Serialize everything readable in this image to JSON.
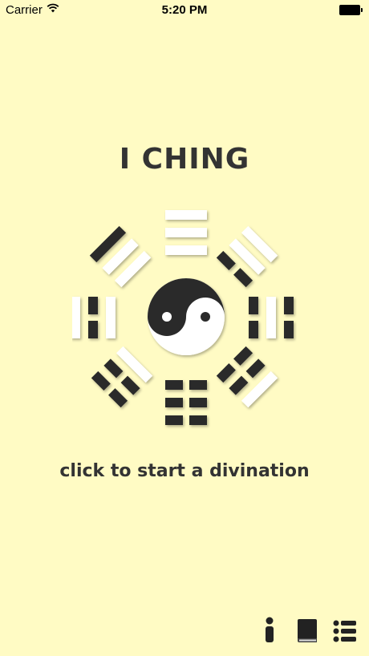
{
  "status_bar": {
    "carrier": "Carrier",
    "time": "5:20 PM",
    "wifi_icon": "wifi-icon",
    "battery_icon": "battery-full-icon"
  },
  "title": "I CHING",
  "bagua": {
    "center_icon": "yin-yang-icon",
    "trigram_dark": "#2b2b2b",
    "trigram_light": "#ffffff"
  },
  "prompt": "click to start a divination",
  "toolbar": {
    "info_icon": "info-icon",
    "book_icon": "book-icon",
    "list_icon": "list-icon"
  },
  "colors": {
    "background": "#fffbc4",
    "text": "#333333"
  }
}
